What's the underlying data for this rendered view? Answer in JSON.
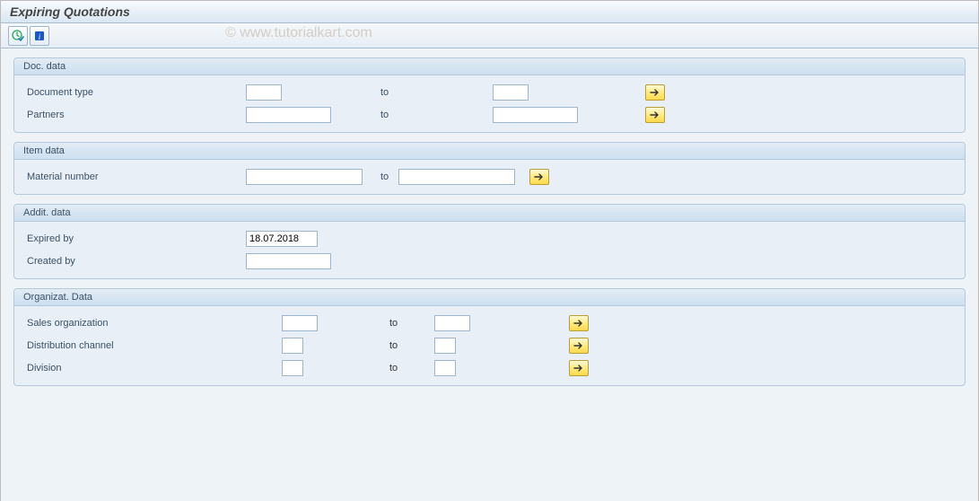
{
  "title": "Expiring Quotations",
  "watermark": "© www.tutorialkart.com",
  "labels": {
    "to": "to"
  },
  "groups": {
    "docData": {
      "title": "Doc. data",
      "docType": {
        "label": "Document type",
        "from": "",
        "to": ""
      },
      "partners": {
        "label": "Partners",
        "from": "",
        "to": ""
      }
    },
    "itemData": {
      "title": "Item data",
      "material": {
        "label": "Material number",
        "from": "",
        "to": ""
      }
    },
    "additData": {
      "title": "Addit. data",
      "expiredBy": {
        "label": "Expired by",
        "value": "18.07.2018"
      },
      "createdBy": {
        "label": "Created by",
        "value": ""
      }
    },
    "orgData": {
      "title": "Organizat. Data",
      "salesOrg": {
        "label": "Sales organization",
        "from": "",
        "to": ""
      },
      "distChannel": {
        "label": "Distribution channel",
        "from": "",
        "to": ""
      },
      "division": {
        "label": "Division",
        "from": "",
        "to": ""
      }
    }
  }
}
